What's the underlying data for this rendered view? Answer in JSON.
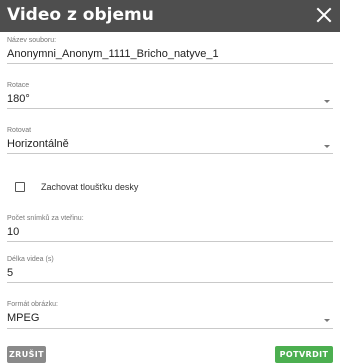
{
  "dialog": {
    "title": "Video z objemu",
    "close_icon": "close-icon"
  },
  "fields": {
    "filename": {
      "label": "Název souboru:",
      "value": "Anonymni_Anonym_1111_Bricho_natyve_1"
    },
    "rotation": {
      "label": "Rotace",
      "value": "180°"
    },
    "rotate": {
      "label": "Rotovat",
      "value": "Horizontálně"
    },
    "keep_thickness": {
      "label": "Zachovat tloušťku desky",
      "checked": false
    },
    "fps": {
      "label": "Počet snímků za vteřinu:",
      "value": "10"
    },
    "duration": {
      "label": "Délka videa (s)",
      "value": "5"
    },
    "format": {
      "label": "Formát obrázku:",
      "value": "MPEG"
    }
  },
  "buttons": {
    "cancel": "ZRUŠIT",
    "confirm": "POTVRDIT"
  },
  "colors": {
    "titlebar": "#4e4e4e",
    "confirm": "#4caf50",
    "cancel": "#8a8a8a"
  }
}
